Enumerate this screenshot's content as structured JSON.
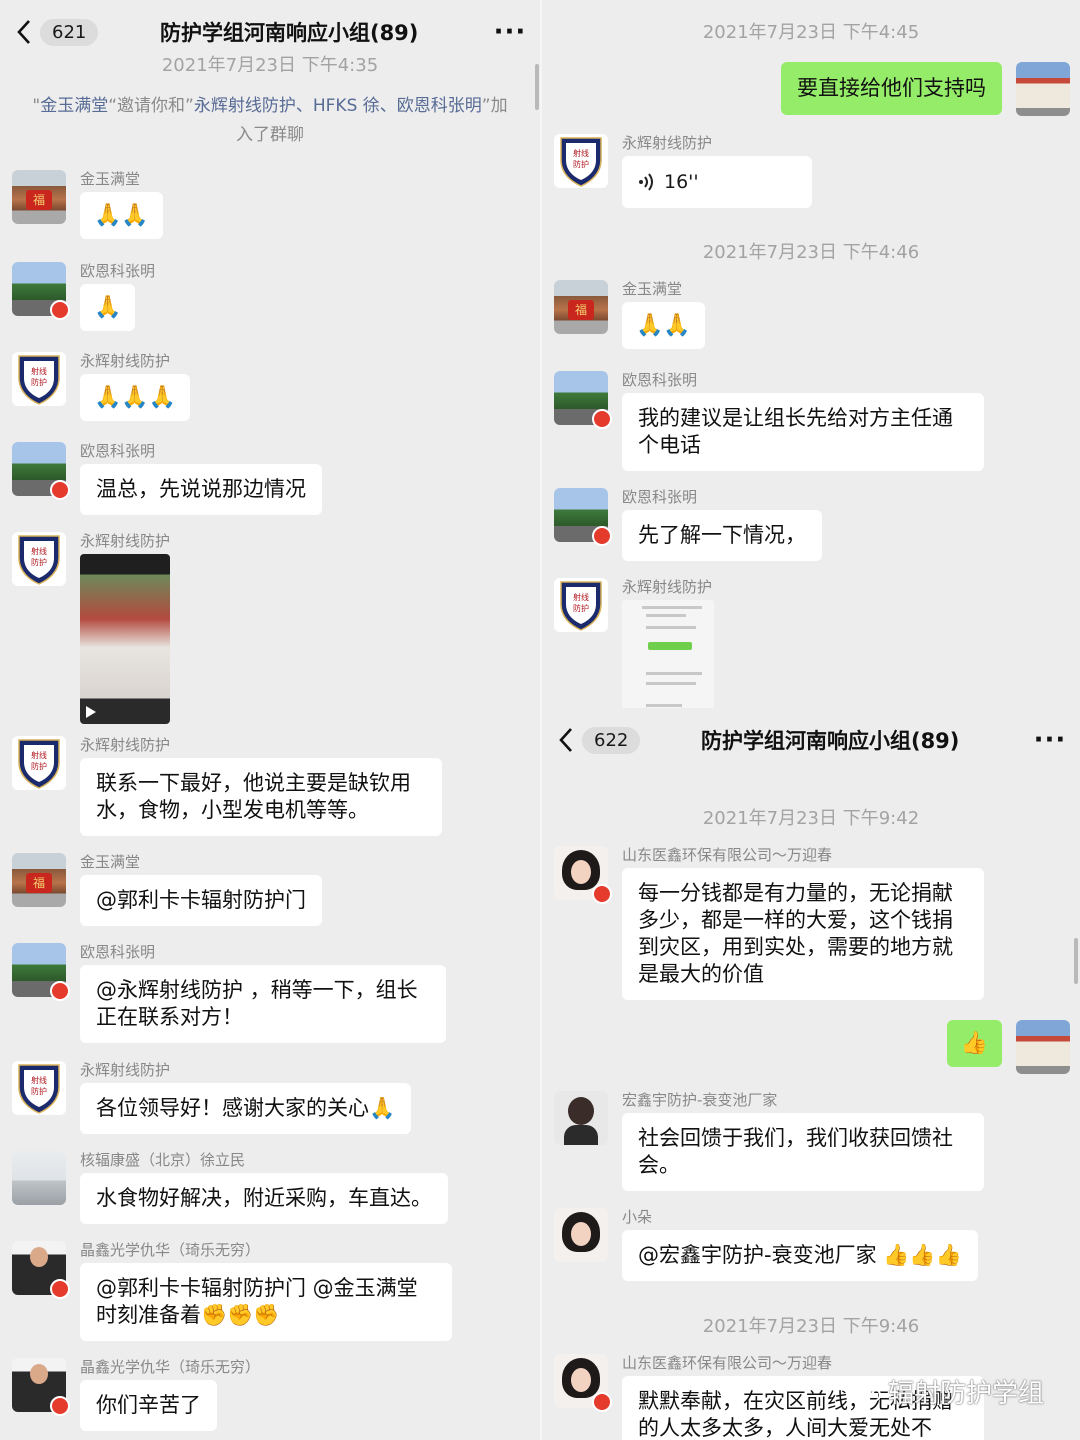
{
  "left": {
    "header": {
      "count": "621",
      "title": "防护学组河南响应小组(89)",
      "more": "···"
    },
    "timestamp_partial": "2021年7月23日 下午4:35",
    "system": {
      "inviter": "金玉满堂",
      "text1": "“邀请你和”",
      "invitees": "永辉射线防护、HFKS 徐、欧恩科张明",
      "text2": "”加入了群聊"
    },
    "messages": [
      {
        "sender": "金玉满堂",
        "emoji": "🙏🙏"
      },
      {
        "sender": "欧恩科张明",
        "emoji": "🙏"
      },
      {
        "sender": "永辉射线防护",
        "emoji": "🙏🙏🙏"
      },
      {
        "sender": "欧恩科张明",
        "text": "温总，先说说那边情况"
      },
      {
        "sender": "永辉射线防护"
      },
      {
        "sender": "永辉射线防护",
        "text": "联系一下最好，他说主要是缺钦用水，食物，小型发电机等等。"
      },
      {
        "sender": "金玉满堂",
        "text": "@郭利卡卡辐射防护门"
      },
      {
        "sender": "欧恩科张明",
        "text": "@永辉射线防护 ，稍等一下，组长正在联系对方！"
      },
      {
        "sender": "永辉射线防护",
        "text": "各位领导好！感谢大家的关心🙏"
      },
      {
        "sender": "核辐康盛（北京）徐立民",
        "text": "水食物好解决，附近采购，车直达。"
      },
      {
        "sender": "晶鑫光学仇华（琦乐无穷）",
        "text": "@郭利卡卡辐射防护门 @金玉满堂 时刻准备着✊✊✊"
      },
      {
        "sender": "晶鑫光学仇华（琦乐无穷）",
        "text": "你们辛苦了"
      }
    ]
  },
  "right": {
    "ts1": "2021年7月23日 下午4:45",
    "self_msg1": "要直接给他们支持吗",
    "voice": {
      "sender": "永辉射线防护",
      "duration": "16''"
    },
    "ts2": "2021年7月23日 下午4:46",
    "m1": {
      "sender": "金玉满堂",
      "emoji": "🙏🙏"
    },
    "m2": {
      "sender": "欧恩科张明",
      "text": "我的建议是让组长先给对方主任通个电话"
    },
    "m3": {
      "sender": "欧恩科张明",
      "text": "先了解一下情况，"
    },
    "m4": {
      "sender": "永辉射线防护"
    },
    "header2": {
      "count": "622",
      "title": "防护学组河南响应小组(89)",
      "more": "···"
    },
    "ts3": "2021年7月23日 下午9:42",
    "m5": {
      "sender": "山东医鑫环保有限公司～万迎春",
      "text": "每一分钱都是有力量的，无论捐献多少，都是一样的大爱，这个钱捐到灾区，用到实处，需要的地方就是最大的价值"
    },
    "self_msg2": "👍",
    "m6": {
      "sender": "宏鑫宇防护-衰变池厂家",
      "text": "社会回馈于我们，我们收获回馈社会。"
    },
    "m7": {
      "sender": "小朵",
      "text": "@宏鑫宇防护-衰变池厂家 👍👍👍"
    },
    "ts4": "2021年7月23日 下午9:46",
    "m8": {
      "sender": "山东医鑫环保有限公司～万迎春",
      "text": "默默奉献，在灾区前线，无私捐赠的人太多太多，人间大爱无处不"
    },
    "watermark": "辐射防护学组"
  },
  "colors": {
    "bubble_self": "#95ec69",
    "bubble_other": "#ffffff",
    "background": "#ededed",
    "link": "#576b95"
  }
}
